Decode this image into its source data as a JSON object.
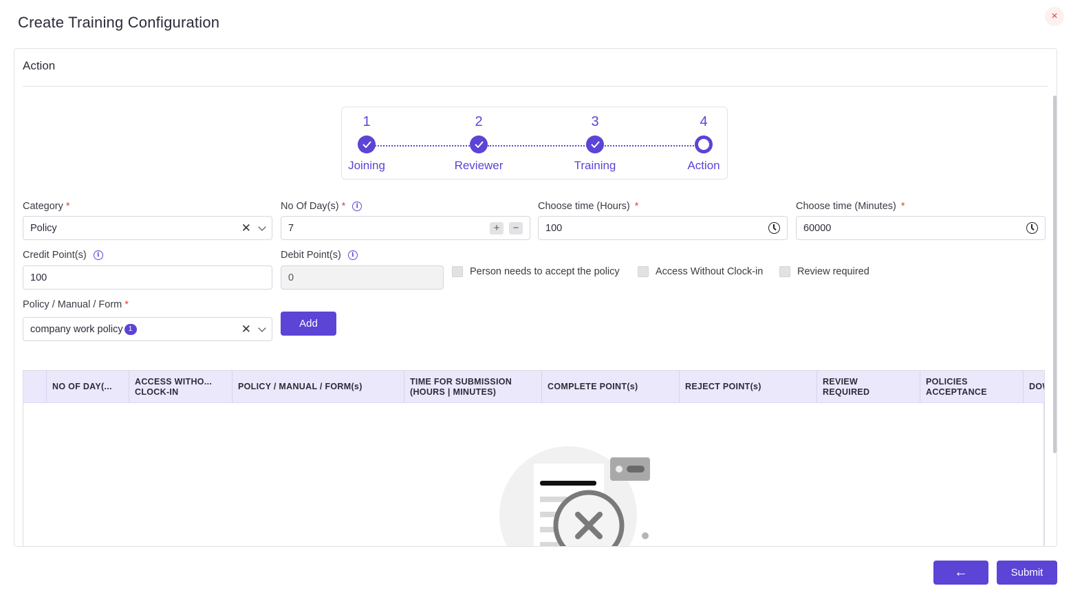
{
  "modal": {
    "title": "Create Training Configuration",
    "close_glyph": "×"
  },
  "panel": {
    "title": "Action"
  },
  "stepper": {
    "steps": [
      {
        "number": "1",
        "label": "Joining",
        "state": "done"
      },
      {
        "number": "2",
        "label": "Reviewer",
        "state": "done"
      },
      {
        "number": "3",
        "label": "Training",
        "state": "done"
      },
      {
        "number": "4",
        "label": "Action",
        "state": "current"
      }
    ]
  },
  "form": {
    "category": {
      "label": "Category",
      "required": "*",
      "value": "Policy"
    },
    "days": {
      "label": "No Of Day(s)",
      "required": "*",
      "value": "7",
      "plus": "+",
      "minus": "−"
    },
    "hours": {
      "label": "Choose time (Hours)",
      "required": "*",
      "value": "100"
    },
    "minutes": {
      "label": "Choose time (Minutes)",
      "required": "*",
      "value": "60000"
    },
    "credit": {
      "label": "Credit Point(s)",
      "value": "100"
    },
    "debit": {
      "label": "Debit Point(s)",
      "value": "0"
    },
    "checkboxes": [
      {
        "label": "Person needs to accept the policy",
        "checked": false
      },
      {
        "label": "Access Without Clock-in",
        "checked": false
      },
      {
        "label": "Review required",
        "checked": false
      }
    ],
    "policy": {
      "label": "Policy / Manual / Form",
      "required": "*",
      "value": "company work policy",
      "count": "1"
    },
    "add_label": "Add",
    "clear_glyph": "✕"
  },
  "table": {
    "columns": [
      "",
      "NO OF DAY(...",
      "ACCESS WITHO...\nCLOCK-IN",
      "POLICY / MANUAL / FORM(s)",
      "TIME FOR SUBMISSION\n(HOURS | MINUTES)",
      "COMPLETE POINT(s)",
      "REJECT POINT(s)",
      "REVIEW\nREQUIRED",
      "POLICIES\nACCEPTANCE",
      "DOWNLOAD"
    ],
    "rows": []
  },
  "footer": {
    "back_glyph": "←",
    "submit_label": "Submit"
  },
  "colors": {
    "accent": "#5b44d6",
    "header_bg": "#ece8fb",
    "danger": "#e0413c"
  }
}
